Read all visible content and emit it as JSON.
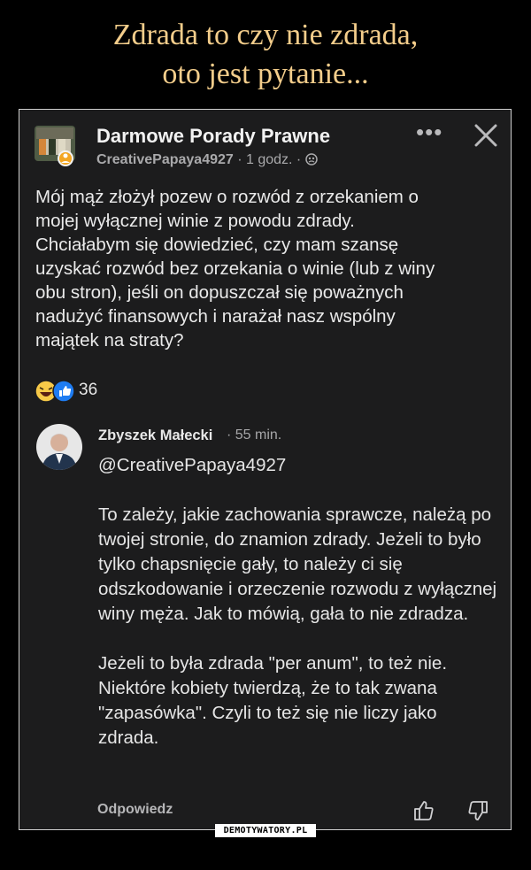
{
  "meme": {
    "title_line1": "Zdrada to czy nie zdrada,",
    "title_line2": "oto jest pytanie...",
    "watermark": "DEMOTYWATORY.PL"
  },
  "post": {
    "page_name": "Darmowe Porady Prawne",
    "author": "CreativePapaya4927",
    "time": " · 1 godz. · ",
    "privacy_icon": "anonymous-user-icon",
    "more_icon": "ellipsis-icon",
    "close_icon": "close-icon",
    "body": "Mój mąż złożył pozew o rozwód z orzekaniem o\nmojej wyłącznej winie z powodu zdrady.\nChciałabym się dowiedzieć, czy mam szansę\nuzyskać rozwód bez orzekania o winie (lub z winy\nobu stron), jeśli on dopuszczał się poważnych\nnadużyć finansowych i narażał nasz wspólny\nmajątek na straty?",
    "reaction_icons": [
      "laugh-reaction-icon",
      "like-reaction-icon"
    ],
    "reaction_count": "36"
  },
  "comment": {
    "author": "Zbyszek Małecki",
    "time": "· 55 min.",
    "mention": "@CreativePapaya4927",
    "paragraph1": "To zależy, jakie zachowania sprawcze, należą po twojej stronie, do znamion zdrady. Jeżeli to było tylko chapsnięcie gały, to należy ci się odszkodowanie i orzeczenie rozwodu z wyłącznej winy męża. Jak to mówią, gała to nie zdradza.",
    "paragraph2": "Jeżeli to była zdrada \"per anum\", to też nie. Niektóre kobiety twierdzą, że to tak zwana \"zapasówka\". Czyli to też się nie liczy jako zdrada.",
    "reply_label": "Odpowiedz",
    "like_icon": "thumbs-up-icon",
    "dislike_icon": "thumbs-down-icon"
  },
  "colors": {
    "title": "#f3cd8b",
    "card_background": "#1c1c1d",
    "text": "#eaeaea",
    "muted_text": "#a9a9ab"
  }
}
